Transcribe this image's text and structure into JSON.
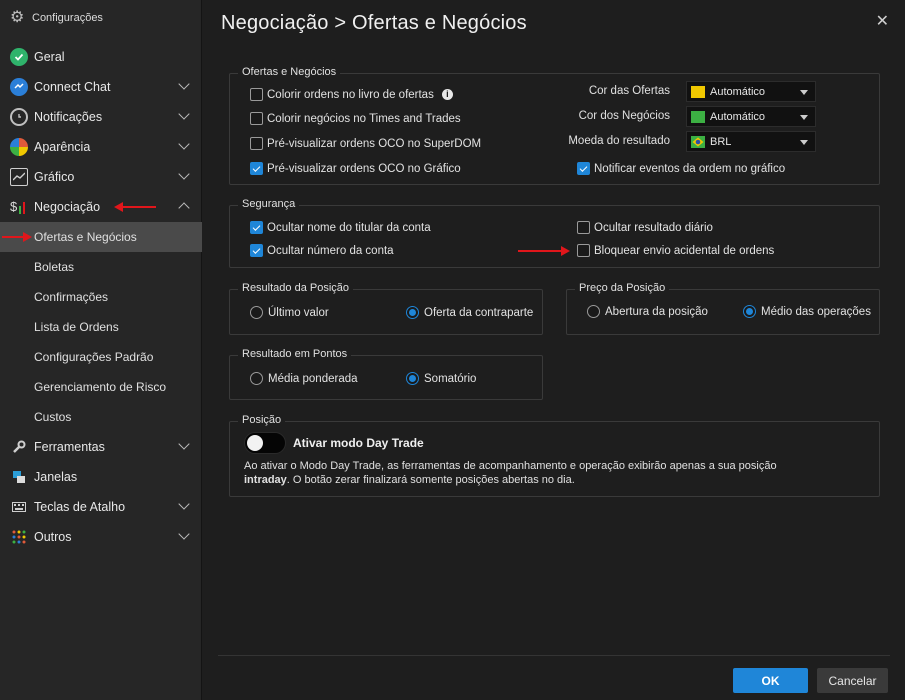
{
  "window": {
    "title": "Configurações",
    "page_title": "Negociação > Ofertas e Negócios"
  },
  "sidebar": {
    "items": [
      {
        "label": "Geral",
        "icon": "check-circle-icon",
        "color": "#2fb36b"
      },
      {
        "label": "Connect Chat",
        "icon": "chat-icon",
        "color": "#2b7fd8"
      },
      {
        "label": "Notificações",
        "icon": "alarm-clock-icon",
        "color": "#bfbfbf"
      },
      {
        "label": "Aparência",
        "icon": "color-wheel-icon",
        "color": "#e05a3a"
      },
      {
        "label": "Gráfico",
        "icon": "line-chart-icon",
        "color": "#cfcfcf"
      },
      {
        "label": "Negociação",
        "icon": "dollar-chart-icon",
        "color": "#cfcfcf"
      }
    ],
    "subitems": [
      "Ofertas e Negócios",
      "Boletas",
      "Confirmações",
      "Lista de Ordens",
      "Configurações Padrão",
      "Gerenciamento de Risco",
      "Custos"
    ],
    "bottom_items": [
      {
        "label": "Ferramentas",
        "icon": "wrench-icon"
      },
      {
        "label": "Janelas",
        "icon": "windows-icon"
      },
      {
        "label": "Teclas de Atalho",
        "icon": "keyboard-icon"
      },
      {
        "label": "Outros",
        "icon": "dots-grid-icon"
      }
    ]
  },
  "ofertas": {
    "title": "Ofertas e Negócios",
    "cb1": "Colorir ordens no livro de ofertas",
    "cb2": "Colorir negócios no Times and Trades",
    "cb3": "Pré-visualizar ordens OCO no SuperDOM",
    "cb4": "Pré-visualizar ordens OCO no Gráfico",
    "cb5": "Notificar eventos da ordem no gráfico",
    "cor_ofertas_label": "Cor das Ofertas",
    "cor_ofertas_value": "Automático",
    "cor_ofertas_color": "#f0c800",
    "cor_negocios_label": "Cor dos Negócios",
    "cor_negocios_value": "Automático",
    "cor_negocios_color": "#3cb043",
    "moeda_label": "Moeda do resultado",
    "moeda_value": "BRL"
  },
  "seguranca": {
    "title": "Segurança",
    "cb1": "Ocultar nome do titular da conta",
    "cb2": "Ocultar número da conta",
    "cb3": "Ocultar resultado diário",
    "cb4": "Bloquear envio acidental de ordens"
  },
  "resultado_posicao": {
    "title": "Resultado da Posição",
    "opt1": "Último valor",
    "opt2": "Oferta da contraparte"
  },
  "preco_posicao": {
    "title": "Preço da Posição",
    "opt1": "Abertura da posição",
    "opt2": "Médio das operações"
  },
  "resultado_pontos": {
    "title": "Resultado em Pontos",
    "opt1": "Média ponderada",
    "opt2": "Somatório"
  },
  "posicao": {
    "title": "Posição",
    "toggle_label": "Ativar modo Day Trade",
    "desc_line1": "Ao ativar o Modo Day Trade, as ferramentas de acompanhamento e operação exibirão apenas a sua posição",
    "desc_bold": "intraday",
    "desc_line2": ". O botão zerar finalizará somente posições abertas no dia."
  },
  "footer": {
    "ok": "OK",
    "cancel": "Cancelar"
  },
  "colors": {
    "accent": "#1f86d8",
    "annotation_arrow": "#e0161b"
  }
}
